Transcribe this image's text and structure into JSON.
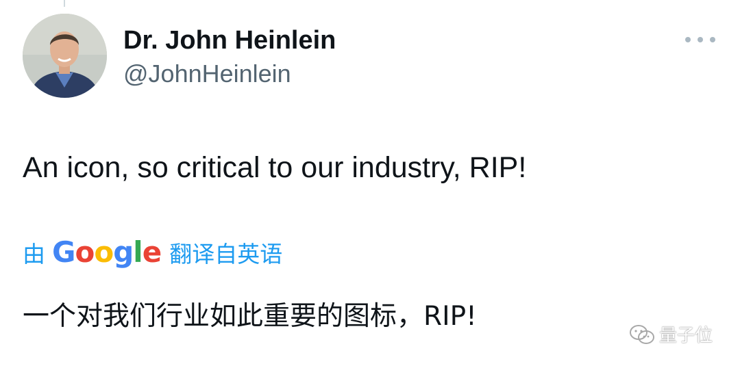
{
  "tweet": {
    "display_name": "Dr. John Heinlein",
    "handle": "@JohnHeinlein",
    "text": "An icon, so critical to our industry, RIP!",
    "translation": {
      "prefix": "由",
      "provider": "Google",
      "suffix": "翻译自英语",
      "text": "一个对我们行业如此重要的图标，RIP!"
    }
  },
  "google_logo_colors": [
    "#4285F4",
    "#EA4335",
    "#FBBC05",
    "#4285F4",
    "#34A853",
    "#EA4335"
  ],
  "icons": {
    "more": "more-horizontal-icon",
    "avatar": "profile-photo",
    "watermark": "wechat-icon"
  },
  "watermark": {
    "text": "量子位"
  },
  "colors": {
    "text": "#0f1419",
    "secondary": "#536471",
    "link": "#1d9bf0"
  }
}
